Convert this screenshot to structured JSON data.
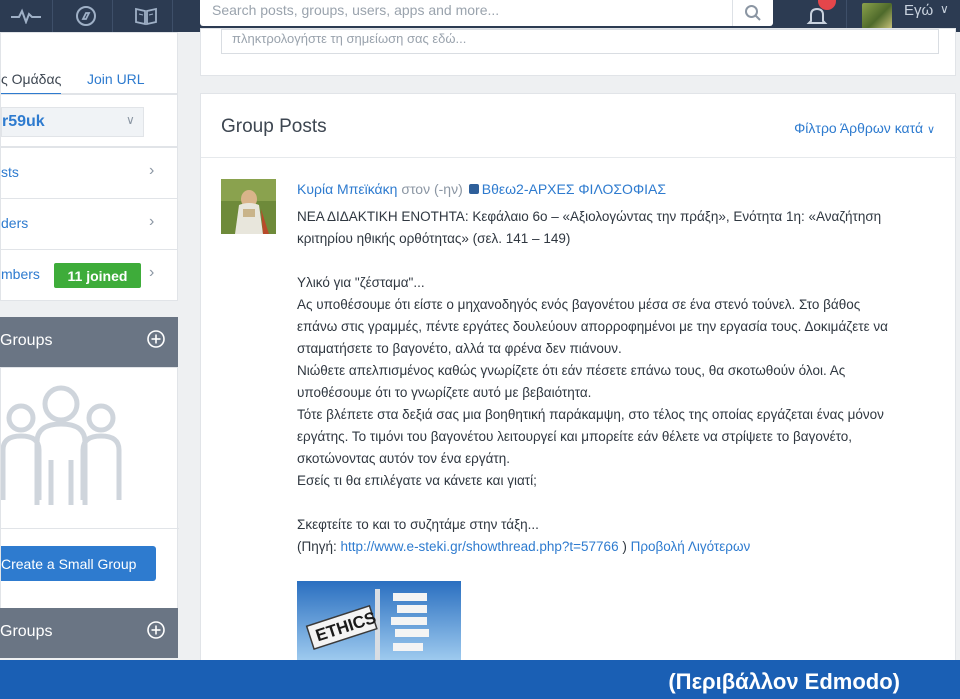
{
  "topbar": {
    "search_placeholder": "Search posts, groups, users, apps and more...",
    "me_label": "Εγώ"
  },
  "sidebar": {
    "tabs": [
      "ς Ομάδας",
      "Join URL"
    ],
    "group_code": "r59uk",
    "rows": [
      {
        "label": "sts"
      },
      {
        "label": "ders"
      },
      {
        "label": "mbers",
        "badge": "11 joined"
      }
    ],
    "small_groups_header": "Groups",
    "create_button": "Create a Small Group",
    "groups_header_2": "Groups"
  },
  "note": {
    "placeholder": "πληκτρολογήστε τη σημείωση σας εδώ..."
  },
  "posts": {
    "title": "Group Posts",
    "filter_label": "Φίλτρο Άρθρων κατά",
    "post": {
      "author": "Κυρία Μπεϊκάκη",
      "to_text": "στον (-ην)",
      "group_name": "Βθεω2-ΑΡΧΕΣ ΦΙΛΟΣΟΦΙΑΣ",
      "lines": [
        "ΝΕΑ ΔΙΔΑΚΤΙΚΗ ΕΝΟΤΗΤΑ: Κεφάλαιο 6ο – «Αξιολογώντας την πράξη», Ενότητα 1η: «Αναζήτηση",
        "κριτηρίου ηθικής ορθότητας» (σελ. 141 – 149)",
        "",
        "Υλικό για \"ζέσταμα\"...",
        "Ας υποθέσουμε ότι είστε ο μηχανοδηγός ενός βαγονέτου μέσα σε ένα στενό τούνελ. Στο βάθος",
        "επάνω στις γραμμές, πέντε εργάτες δουλεύουν απορροφημένοι με την εργασία τους. Δοκιμάζετε να",
        "σταματήσετε το βαγονέτο, αλλά τα φρένα δεν πιάνουν.",
        "Νιώθετε απελπισμένος καθώς γνωρίζετε ότι εάν πέσετε επάνω τους, θα σκοτωθούν όλοι. Ας",
        "υποθέσουμε ότι το γνωρίζετε αυτό με βεβαιότητα.",
        "Τότε βλέπετε στα δεξιά σας μια βοηθητική παράκαμψη, στο τέλος της οποίας εργάζεται ένας μόνον",
        "εργάτης. Το τιμόνι του βαγονέτου λειτουργεί και μπορείτε εάν θέλετε να στρίψετε το βαγονέτο,",
        "σκοτώνοντας αυτόν τον ένα εργάτη.",
        "Εσείς τι θα επιλέγατε να κάνετε και γιατί;",
        "",
        "Σκεφτείτε το και το συζητάμε στην τάξη..."
      ],
      "source_prefix": "(Πηγή:",
      "source_url": "http://www.e-steki.gr/showthread.php?t=57766",
      "source_close": ")",
      "show_less": "Προβολή Λιγότερων",
      "image_text": "ETHICS"
    }
  },
  "footer": {
    "caption": "(Περιβάλλον Edmodo)"
  }
}
